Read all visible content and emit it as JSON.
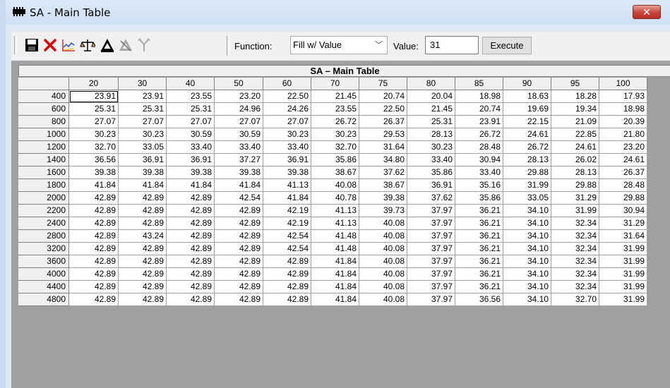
{
  "window": {
    "title": "SA - Main Table",
    "close_label": "✕"
  },
  "toolbar": {
    "function_label": "Function:",
    "function_value": "Fill w/ Value",
    "value_label": "Value:",
    "value": "31",
    "execute_label": "Execute",
    "icons": [
      "save-icon",
      "delete-icon",
      "graph-icon",
      "balance-icon",
      "triangle-icon",
      "triangle-disabled-icon",
      "fork-icon"
    ]
  },
  "table": {
    "title": "SA – Main Table",
    "columns": [
      "20",
      "30",
      "40",
      "50",
      "60",
      "70",
      "75",
      "80",
      "85",
      "90",
      "95",
      "100"
    ],
    "rows": [
      {
        "label": "400",
        "values": [
          "23.91",
          "23.91",
          "23.55",
          "23.20",
          "22.50",
          "21.45",
          "20.74",
          "20.04",
          "18.98",
          "18.63",
          "18.28",
          "17.93"
        ]
      },
      {
        "label": "600",
        "values": [
          "25.31",
          "25.31",
          "25.31",
          "24.96",
          "24.26",
          "23.55",
          "22.50",
          "21.45",
          "20.74",
          "19.69",
          "19.34",
          "18.98"
        ]
      },
      {
        "label": "800",
        "values": [
          "27.07",
          "27.07",
          "27.07",
          "27.07",
          "27.07",
          "26.72",
          "26.37",
          "25.31",
          "23.91",
          "22.15",
          "21.09",
          "20.39"
        ]
      },
      {
        "label": "1000",
        "values": [
          "30.23",
          "30.23",
          "30.59",
          "30.59",
          "30.23",
          "30.23",
          "29.53",
          "28.13",
          "26.72",
          "24.61",
          "22.85",
          "21.80"
        ]
      },
      {
        "label": "1200",
        "values": [
          "32.70",
          "33.05",
          "33.40",
          "33.40",
          "33.40",
          "32.70",
          "31.64",
          "30.23",
          "28.48",
          "26.72",
          "24.61",
          "23.20"
        ]
      },
      {
        "label": "1400",
        "values": [
          "36.56",
          "36.91",
          "36.91",
          "37.27",
          "36.91",
          "35.86",
          "34.80",
          "33.40",
          "30.94",
          "28.13",
          "26.02",
          "24.61"
        ]
      },
      {
        "label": "1600",
        "values": [
          "39.38",
          "39.38",
          "39.38",
          "39.38",
          "39.38",
          "38.67",
          "37.62",
          "35.86",
          "33.40",
          "29.88",
          "28.13",
          "26.37"
        ]
      },
      {
        "label": "1800",
        "values": [
          "41.84",
          "41.84",
          "41.84",
          "41.84",
          "41.13",
          "40.08",
          "38.67",
          "36.91",
          "35.16",
          "31.99",
          "29.88",
          "28.48"
        ]
      },
      {
        "label": "2000",
        "values": [
          "42.89",
          "42.89",
          "42.89",
          "42.54",
          "41.84",
          "40.78",
          "39.38",
          "37.62",
          "35.86",
          "33.05",
          "31.29",
          "29.88"
        ]
      },
      {
        "label": "2200",
        "values": [
          "42.89",
          "42.89",
          "42.89",
          "42.89",
          "42.19",
          "41.13",
          "39.73",
          "37.97",
          "36.21",
          "34.10",
          "31.99",
          "30.94"
        ]
      },
      {
        "label": "2400",
        "values": [
          "42.89",
          "42.89",
          "42.89",
          "42.89",
          "42.19",
          "41.13",
          "40.08",
          "37.97",
          "36.21",
          "34.10",
          "32.34",
          "31.29"
        ]
      },
      {
        "label": "2800",
        "values": [
          "42.89",
          "43.24",
          "42.89",
          "42.89",
          "42.54",
          "41.48",
          "40.08",
          "37.97",
          "36.21",
          "34.10",
          "32.34",
          "31.64"
        ]
      },
      {
        "label": "3200",
        "values": [
          "42.89",
          "42.89",
          "42.89",
          "42.89",
          "42.54",
          "41.48",
          "40.08",
          "37.97",
          "36.21",
          "34.10",
          "32.34",
          "31.99"
        ]
      },
      {
        "label": "3600",
        "values": [
          "42.89",
          "42.89",
          "42.89",
          "42.89",
          "42.89",
          "41.84",
          "40.08",
          "37.97",
          "36.21",
          "34.10",
          "32.34",
          "31.99"
        ]
      },
      {
        "label": "4000",
        "values": [
          "42.89",
          "42.89",
          "42.89",
          "42.89",
          "42.89",
          "41.84",
          "40.08",
          "37.97",
          "36.21",
          "34.10",
          "32.34",
          "31.99"
        ]
      },
      {
        "label": "4400",
        "values": [
          "42.89",
          "42.89",
          "42.89",
          "42.89",
          "42.89",
          "41.84",
          "40.08",
          "37.97",
          "36.21",
          "34.10",
          "32.34",
          "31.99"
        ]
      },
      {
        "label": "4800",
        "values": [
          "42.89",
          "42.89",
          "42.89",
          "42.89",
          "42.89",
          "41.84",
          "40.08",
          "37.97",
          "36.56",
          "34.10",
          "32.70",
          "31.99"
        ]
      }
    ]
  }
}
